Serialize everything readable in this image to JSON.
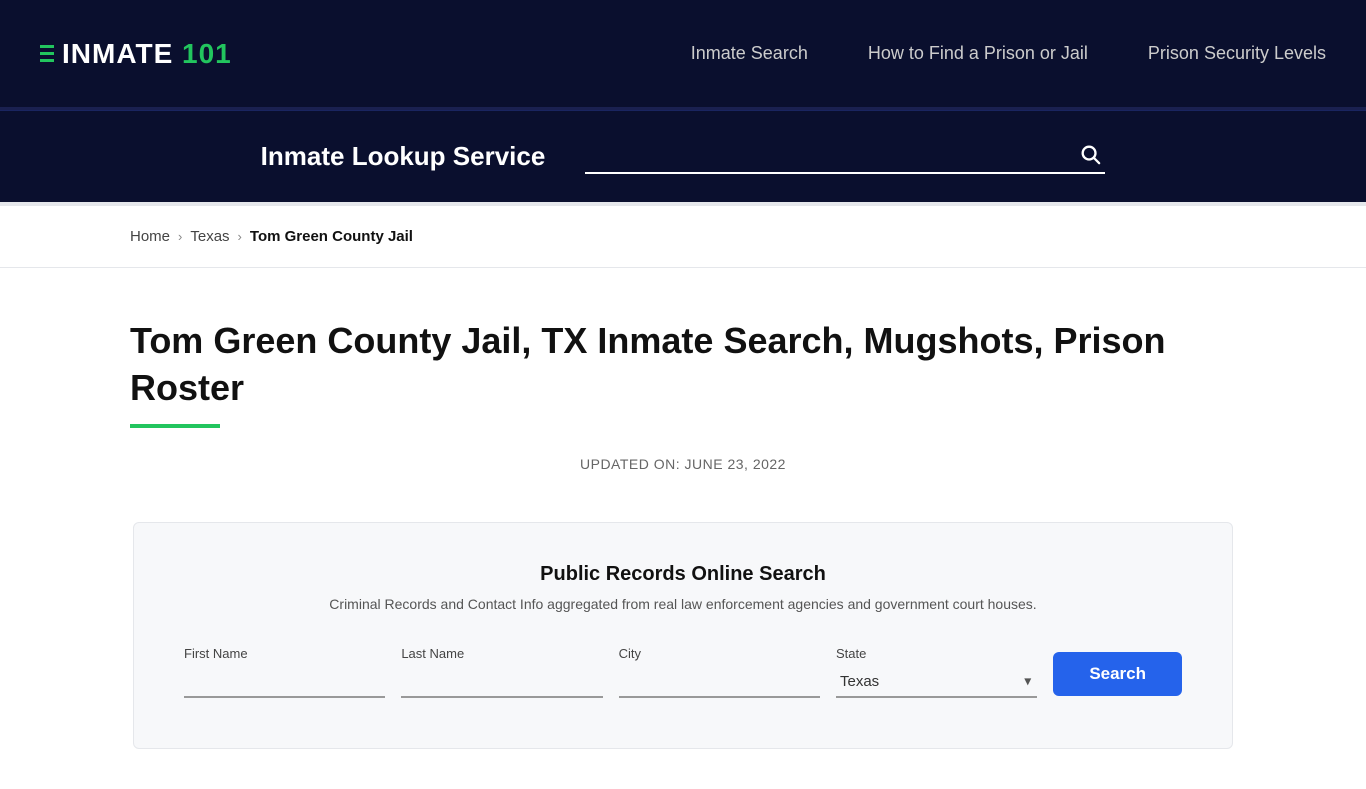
{
  "site": {
    "logo_text": "INMATE 101",
    "logo_highlight": "101"
  },
  "nav": {
    "links": [
      {
        "label": "Inmate Search",
        "href": "#"
      },
      {
        "label": "How to Find a Prison or Jail",
        "href": "#"
      },
      {
        "label": "Prison Security Levels",
        "href": "#"
      }
    ]
  },
  "search_bar": {
    "label": "Inmate Lookup Service",
    "placeholder": ""
  },
  "breadcrumb": {
    "home": "Home",
    "state": "Texas",
    "current": "Tom Green County Jail"
  },
  "page": {
    "title": "Tom Green County Jail, TX Inmate Search, Mugshots, Prison Roster",
    "updated": "UPDATED ON: JUNE 23, 2022"
  },
  "records_box": {
    "title": "Public Records Online Search",
    "subtitle": "Criminal Records and Contact Info aggregated from real law enforcement agencies and government court houses.",
    "fields": {
      "first_name_label": "First Name",
      "last_name_label": "Last Name",
      "city_label": "City",
      "state_label": "State",
      "state_value": "Texas"
    },
    "search_button": "Search"
  }
}
